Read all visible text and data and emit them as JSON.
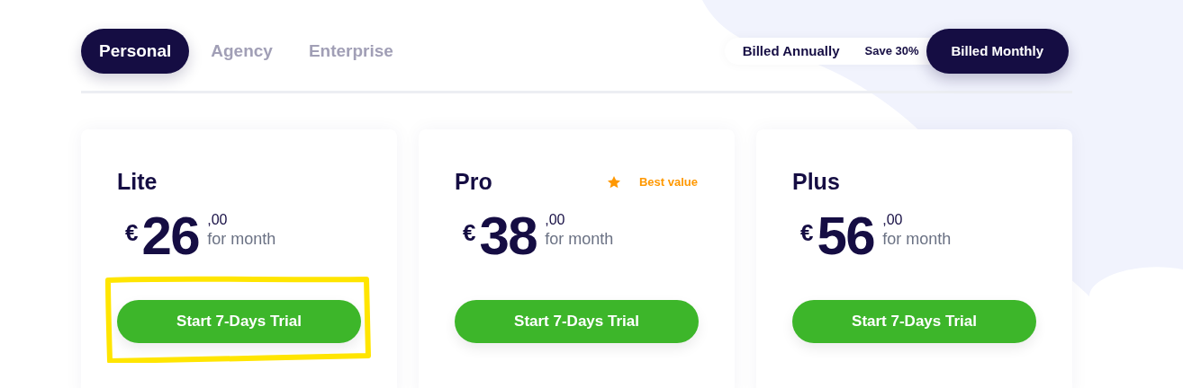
{
  "tabs": [
    {
      "label": "Personal",
      "selected": true
    },
    {
      "label": "Agency",
      "selected": false
    },
    {
      "label": "Enterprise",
      "selected": false
    }
  ],
  "billing": {
    "options": [
      {
        "label": "Billed Annually",
        "badge": "Save 30%",
        "selected": false
      },
      {
        "label": "Billed Monthly",
        "selected": true
      }
    ]
  },
  "plans": [
    {
      "name": "Lite",
      "currency": "€",
      "amount": "26",
      "cents": ",00",
      "period": "for month",
      "button": "Start 7-Days Trial",
      "highlighted": true
    },
    {
      "name": "Pro",
      "badge": "Best value",
      "currency": "€",
      "amount": "38",
      "cents": ",00",
      "period": "for month",
      "button": "Start 7-Days Trial",
      "highlighted": false
    },
    {
      "name": "Plus",
      "currency": "€",
      "amount": "56",
      "cents": ",00",
      "period": "for month",
      "button": "Start 7-Days Trial",
      "highlighted": false
    }
  ]
}
